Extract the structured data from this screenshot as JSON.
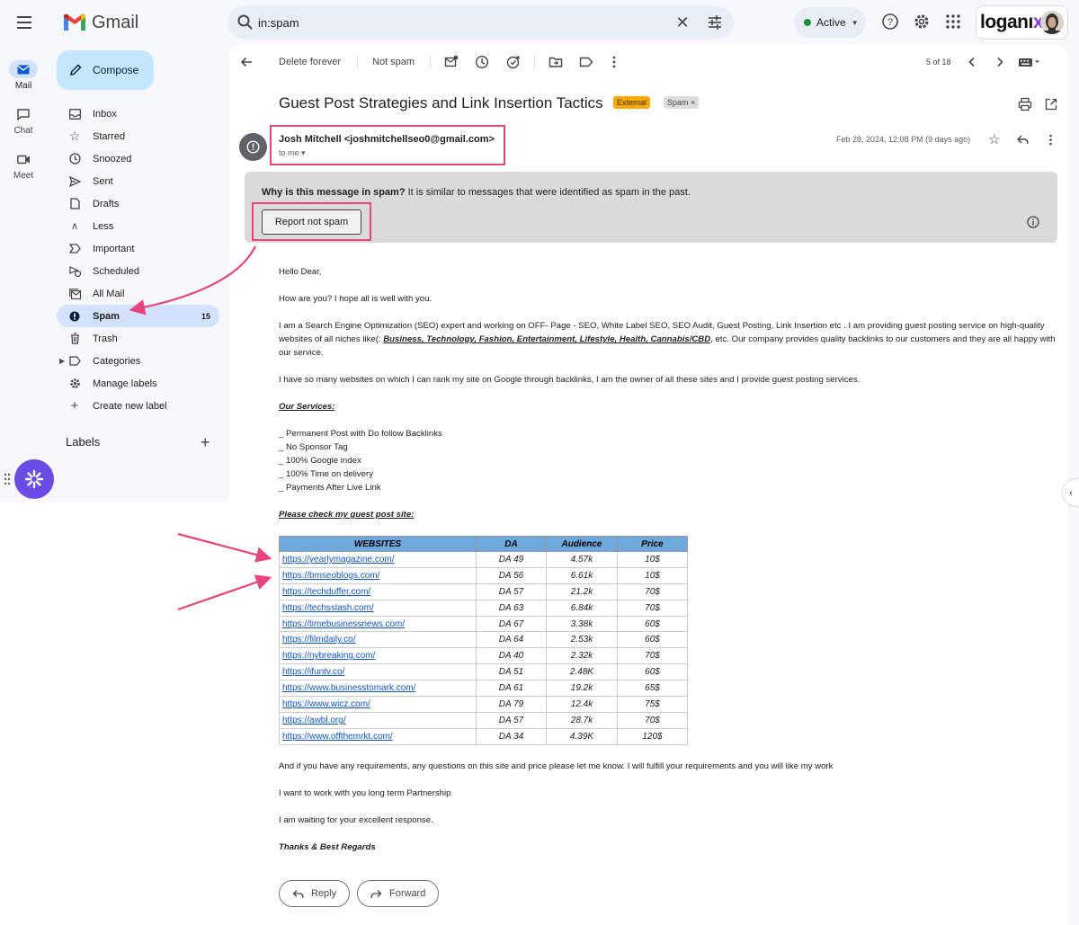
{
  "app": {
    "name": "Gmail"
  },
  "search": {
    "value": "in:spam"
  },
  "status": {
    "label": "Active"
  },
  "brand": {
    "name_main": "loganı",
    "name_x": "x"
  },
  "rail": [
    {
      "label": "Mail"
    },
    {
      "label": "Chat"
    },
    {
      "label": "Meet"
    }
  ],
  "compose": {
    "label": "Compose"
  },
  "nav": {
    "inbox": "Inbox",
    "starred": "Starred",
    "snoozed": "Snoozed",
    "sent": "Sent",
    "drafts": "Drafts",
    "less": "Less",
    "important": "Important",
    "scheduled": "Scheduled",
    "allmail": "All Mail",
    "spam": "Spam",
    "spam_count": "15",
    "trash": "Trash",
    "categories": "Categories",
    "manage_labels": "Manage labels",
    "create_label": "Create new label"
  },
  "labels": {
    "title": "Labels"
  },
  "toolbar": {
    "delete_forever": "Delete forever",
    "not_spam": "Not spam",
    "pager": "5 of 18"
  },
  "email": {
    "subject": "Guest Post Strategies and Link Insertion Tactics",
    "tag_external": "External",
    "tag_spam": "Spam ×",
    "sender": "Josh Mitchell <joshmitchellseo0@gmail.com>",
    "to": "to me ▾",
    "date": "Feb 28, 2024, 12:08 PM (9 days ago)",
    "spam_why_bold": "Why is this message in spam?",
    "spam_why_rest": " It is similar to messages that were identified as spam in the past.",
    "report_not_spam": "Report not spam",
    "greeting": "Hello Dear,",
    "p1": "How are you? I hope all is well with you.",
    "p2a": "I am a Search Engine Optimization (SEO) expert and working on OFF- Page - SEO, White Label SEO, SEO Audit, Guest Posting, Link  Insertion etc . I am providing guest posting service on high-quality websites of all niches like(: ",
    "p2_niches": "Business, Technology, Fashion, Entertainment, Lifestyle, Health, Cannabis/CBD",
    "p2b": ", etc. Our company provides quality backlinks to our customers and they are all happy with our service.",
    "p3": "I have so many websites on which I can rank my site on Google through backlinks, I am the owner of all these sites and I provide guest posting services.",
    "services_title": "Our Services:",
    "services": [
      "_ Permanent Post with Do follow Backlinks",
      "_ No Sponsor Tag",
      "_ 100% Google index",
      "_ 100% Time on delivery",
      "_ Payments After Live Link"
    ],
    "check_title": "Please check my guest post site:",
    "table_headers": [
      "WEBSITES",
      "DA",
      "Audience",
      "Price"
    ],
    "table_rows": [
      [
        "https://yearlymagazine.com/",
        "DA 49",
        "4.57k",
        "10$"
      ],
      [
        "https://bmseoblogs.com/",
        "DA 56",
        "6.61k",
        "10$"
      ],
      [
        "https://techduffer.com/",
        "DA 57",
        "21.2k",
        "70$"
      ],
      [
        "https://techsslash.com/",
        "DA 63",
        "6.84k",
        "70$"
      ],
      [
        "https://timebusinessnews.com/",
        "DA 67",
        "3.38k",
        "60$"
      ],
      [
        "https://filmdaily.co/",
        "DA 64",
        "2.53k",
        "60$"
      ],
      [
        "https://nybreaking.com/",
        "DA 40",
        "2.32k",
        "70$"
      ],
      [
        "https://ifuntv.co/",
        "DA 51",
        "2.48K",
        "60$"
      ],
      [
        "https://www.businesstomark.com/",
        "DA 61",
        "19.2k",
        "65$"
      ],
      [
        "https://www.wicz.com/",
        "DA 79",
        "12.4k",
        "75$"
      ],
      [
        "https://awbl.org/",
        "DA 57",
        "28.7k",
        "70$"
      ],
      [
        "https://www.offthemrkt.com/",
        "DA 34",
        "4.39K",
        "120$"
      ]
    ],
    "p4": "And if you have any requirements, any questions on this site and price please let me know. I will fulfill your requirements and you will like my work",
    "p5": "I want to work with you long term Partnership",
    "p6": "I am waiting for your excellent response.",
    "signoff": "Thanks & Best  Regards"
  },
  "actions": {
    "reply": "Reply",
    "forward": "Forward"
  },
  "colors": {
    "highlight": "#e8447e",
    "spam_nav": "#d3e3fd",
    "compose": "#c2e7ff",
    "table_header": "#6fa8dc"
  }
}
